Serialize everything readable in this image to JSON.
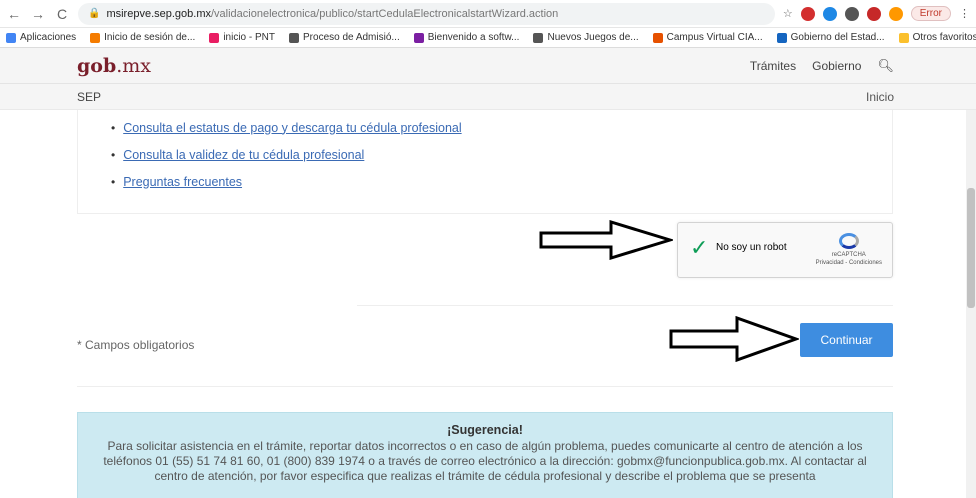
{
  "browser": {
    "url_domain": "msirepve.sep.gob.mx",
    "url_path": "/validacionelectronica/publico/startCedulaElectronicalstartWizard.action",
    "error_label": "Error",
    "bookmarks": [
      "Aplicaciones",
      "Inicio de sesión de...",
      "inicio - PNT",
      "Proceso de Admisió...",
      "Bienvenido a softw...",
      "Nuevos Juegos de...",
      "Campus Virtual CIA...",
      "Gobierno del Estad..."
    ],
    "other_bookmarks": "Otros favoritos"
  },
  "header": {
    "logo_main": "gob",
    "logo_suffix": ".mx",
    "nav": [
      "Trámites",
      "Gobierno"
    ],
    "sub_title": "SEP",
    "sub_link": "Inicio"
  },
  "links": [
    "Consulta el estatus de pago y descarga tu cédula profesional",
    "Consulta la validez de tu cédula profesional",
    "Preguntas frecuentes"
  ],
  "captcha": {
    "label": "No soy un robot",
    "brand": "reCAPTCHA",
    "terms": "Privacidad - Condiciones"
  },
  "form": {
    "required_note": "* Campos obligatorios",
    "continue_label": "Continuar"
  },
  "alert": {
    "title": "¡Sugerencia!",
    "text": "Para solicitar asistencia en el trámite, reportar datos incorrectos o en caso de algún problema, puedes comunicarte al centro de atención a los teléfonos 01 (55) 51 74 81 60, 01 (800) 839 1974 o a través de correo electrónico a la dirección: gobmx@funcionpublica.gob.mx. Al contactar al centro de atención, por favor especifica que realizas el trámite de cédula profesional y describe el problema que se presenta"
  }
}
